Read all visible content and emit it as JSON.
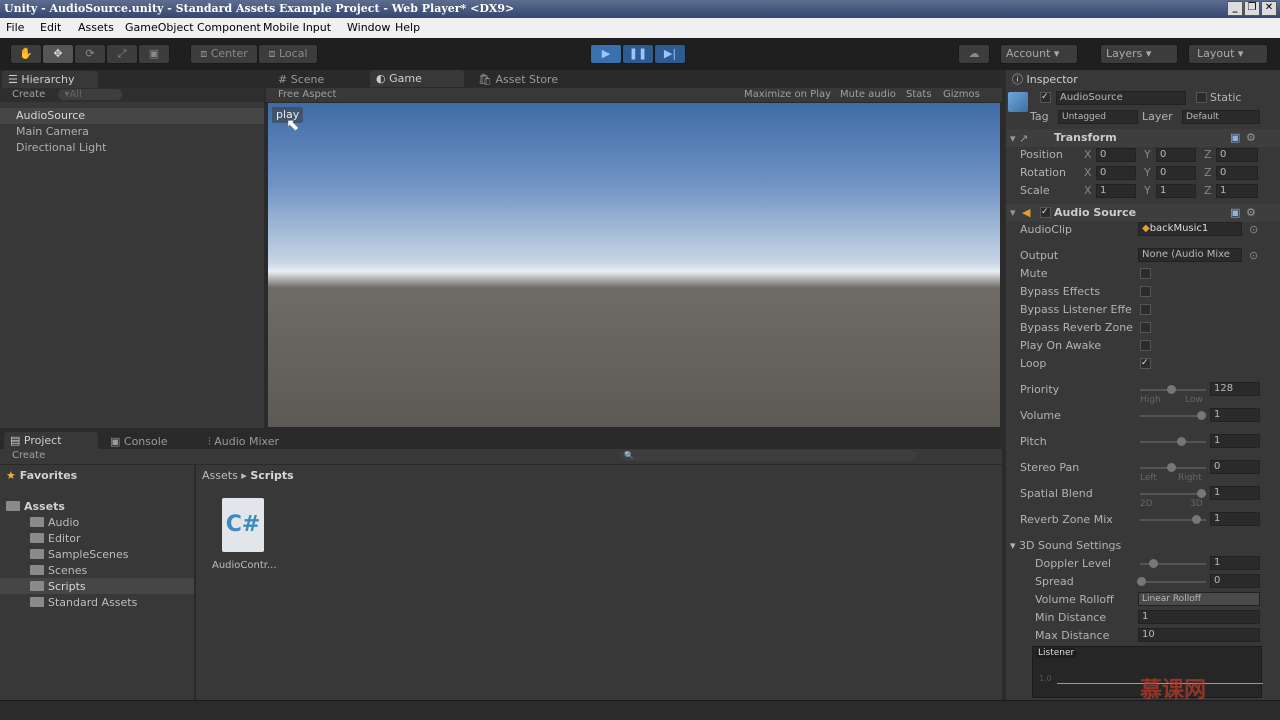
{
  "window": {
    "title": "Unity - AudioSource.unity - Standard Assets Example Project - Web Player* <DX9>"
  },
  "menu": [
    "File",
    "Edit",
    "Assets",
    "GameObject",
    "Component",
    "Mobile Input",
    "Window",
    "Help"
  ],
  "toolbar": {
    "center": "Center",
    "local": "Local",
    "account": "Account",
    "layers": "Layers",
    "layout": "Layout"
  },
  "hierarchy": {
    "tab": "Hierarchy",
    "create": "Create",
    "search": "▾All",
    "items": [
      "AudioSource",
      "Main Camera",
      "Directional Light"
    ]
  },
  "scene_tabs": {
    "scene": "Scene",
    "game": "Game",
    "asset_store": "Asset Store"
  },
  "game_bar": {
    "aspect": "Free Aspect",
    "maximize": "Maximize on Play",
    "mute": "Mute audio",
    "stats": "Stats",
    "gizmos": "Gizmos"
  },
  "game_view": {
    "play_button": "play"
  },
  "project": {
    "tabs": {
      "project": "Project",
      "console": "Console",
      "mixer": "Audio Mixer"
    },
    "create": "Create",
    "favorites": "Favorites",
    "assets": "Assets",
    "folders": [
      "Audio",
      "Editor",
      "SampleScenes",
      "Scenes",
      "Scripts",
      "Standard Assets"
    ],
    "breadcrumb": [
      "Assets",
      "Scripts"
    ],
    "file": {
      "icon": "C#",
      "name": "AudioContr..."
    }
  },
  "inspector": {
    "tab": "Inspector",
    "object_name": "AudioSource",
    "static": "Static",
    "tag_label": "Tag",
    "tag": "Untagged",
    "layer_label": "Layer",
    "layer": "Default",
    "transform": {
      "title": "Transform",
      "rows": [
        {
          "label": "Position",
          "x": "0",
          "y": "0",
          "z": "0"
        },
        {
          "label": "Rotation",
          "x": "0",
          "y": "0",
          "z": "0"
        },
        {
          "label": "Scale",
          "x": "1",
          "y": "1",
          "z": "1"
        }
      ]
    },
    "audio_source": {
      "title": "Audio Source",
      "audioclip_label": "AudioClip",
      "audioclip": "backMusic1",
      "output_label": "Output",
      "output": "None (Audio Mixe",
      "mute": "Mute",
      "bypass_effects": "Bypass Effects",
      "bypass_listener": "Bypass Listener Effe",
      "bypass_reverb": "Bypass Reverb Zone",
      "play_on_awake": "Play On Awake",
      "loop": "Loop",
      "priority_label": "Priority",
      "priority": "128",
      "high": "High",
      "low": "Low",
      "volume_label": "Volume",
      "volume": "1",
      "pitch_label": "Pitch",
      "pitch": "1",
      "stereo_label": "Stereo Pan",
      "stereo": "0",
      "left": "Left",
      "right": "Right",
      "spatial_label": "Spatial Blend",
      "spatial": "1",
      "d2": "2D",
      "d3": "3D",
      "reverb_label": "Reverb Zone Mix",
      "reverb": "1",
      "sound3d": "3D Sound Settings",
      "doppler_label": "Doppler Level",
      "doppler": "1",
      "spread_label": "Spread",
      "spread": "0",
      "rolloff_label": "Volume Rolloff",
      "rolloff": "Linear Rolloff",
      "min_label": "Min Distance",
      "min": "1",
      "max_label": "Max Distance",
      "max": "10",
      "listener": "Listener",
      "graph_tick": "1.0"
    }
  },
  "watermark": "慕课网"
}
